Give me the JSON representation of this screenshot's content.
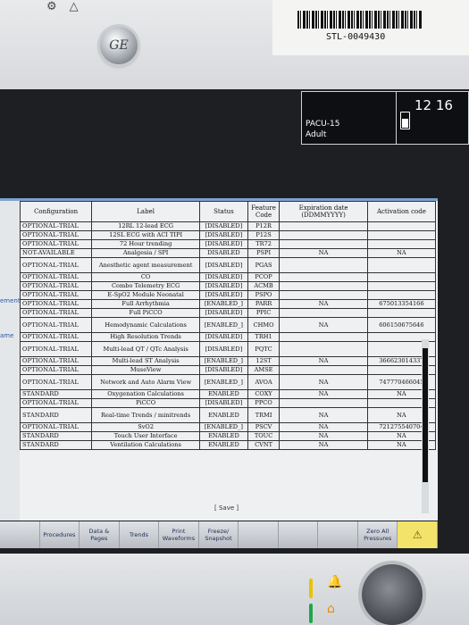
{
  "device": {
    "sticker_code": "STL-0049430",
    "logo": "GE"
  },
  "status": {
    "unit": "PACU-15",
    "patient_type": "Adult",
    "time": "12 16"
  },
  "side_labels": [
    "ement",
    "ame"
  ],
  "table": {
    "headers": [
      "Configuration",
      "Label",
      "Status",
      "Feature Code",
      "Expiration date (DDMMYYYY)",
      "Activation code"
    ],
    "rows": [
      {
        "conf": "OPTIONAL-TRIAL",
        "label": "12RL 12-lead ECG",
        "status": "[DISABLED]",
        "code": "P12R",
        "exp": "",
        "act": "",
        "tall": false
      },
      {
        "conf": "OPTIONAL-TRIAL",
        "label": "12SL ECG with ACI TIPI",
        "status": "[DISABLED]",
        "code": "P12S",
        "exp": "",
        "act": "",
        "tall": false
      },
      {
        "conf": "OPTIONAL-TRIAL",
        "label": "72 Hour trending",
        "status": "[DISABLED]",
        "code": "TR72",
        "exp": "",
        "act": "",
        "tall": false
      },
      {
        "conf": "NOT-AVAILABLE",
        "label": "Analgesia / SPI",
        "status": "DISABLED",
        "code": "PSPI",
        "exp": "NA",
        "act": "NA",
        "tall": false
      },
      {
        "conf": "OPTIONAL-TRIAL",
        "label": "Anesthetic agent measurement",
        "status": "[DISABLED]",
        "code": "PGAS",
        "exp": "",
        "act": "",
        "tall": true
      },
      {
        "conf": "OPTIONAL-TRIAL",
        "label": "CO",
        "status": "[DISABLED]",
        "code": "PCOP",
        "exp": "",
        "act": "",
        "tall": false
      },
      {
        "conf": "OPTIONAL-TRIAL",
        "label": "Combo Telemetry ECG",
        "status": "[DISABLED]",
        "code": "ACMB",
        "exp": "",
        "act": "",
        "tall": false
      },
      {
        "conf": "OPTIONAL-TRIAL",
        "label": "E-SpO2 Module Neonatal",
        "status": "[DISABLED]",
        "code": "PSPO",
        "exp": "",
        "act": "",
        "tall": false
      },
      {
        "conf": "OPTIONAL-TRIAL",
        "label": "Full Arrhythmia",
        "status": "[ENABLED_]",
        "code": "PARR",
        "exp": "NA",
        "act": "675013354166",
        "tall": false
      },
      {
        "conf": "OPTIONAL-TRIAL",
        "label": "Full PiCCO",
        "status": "[DISABLED]",
        "code": "PPIC",
        "exp": "",
        "act": "",
        "tall": false
      },
      {
        "conf": "OPTIONAL-TRIAL",
        "label": "Hemodynamic Calculations",
        "status": "[ENABLED_]",
        "code": "CHMO",
        "exp": "NA",
        "act": "606150675646",
        "tall": true
      },
      {
        "conf": "OPTIONAL-TRIAL",
        "label": "High Resolution Trends",
        "status": "[DISABLED]",
        "code": "TRH1",
        "exp": "",
        "act": "",
        "tall": false
      },
      {
        "conf": "OPTIONAL-TRIAL",
        "label": "Multi-lead QT / QTc Analysis",
        "status": "[DISABLED]",
        "code": "PQTC",
        "exp": "",
        "act": "",
        "tall": true
      },
      {
        "conf": "OPTIONAL-TRIAL",
        "label": "Multi-lead ST Analysis",
        "status": "[ENABLED_]",
        "code": "12ST",
        "exp": "NA",
        "act": "366623014337",
        "tall": false
      },
      {
        "conf": "OPTIONAL-TRIAL",
        "label": "MuseView",
        "status": "[DISABLED]",
        "code": "AMSE",
        "exp": "",
        "act": "",
        "tall": false
      },
      {
        "conf": "OPTIONAL-TRIAL",
        "label": "Network and Auto Alarm View",
        "status": "[ENABLED_]",
        "code": "AVOA",
        "exp": "NA",
        "act": "747770466045",
        "tall": true
      },
      {
        "conf": "STANDARD",
        "label": "Oxygenation Calculations",
        "status": "ENABLED",
        "code": "COXY",
        "exp": "NA",
        "act": "NA",
        "tall": false
      },
      {
        "conf": "OPTIONAL-TRIAL",
        "label": "PiCCO",
        "status": "[DISABLED]",
        "code": "PPCO",
        "exp": "",
        "act": "",
        "tall": false
      },
      {
        "conf": "STANDARD",
        "label": "Real-time Trends / minitrends",
        "status": "ENABLED",
        "code": "TRMI",
        "exp": "NA",
        "act": "NA",
        "tall": true
      },
      {
        "conf": "OPTIONAL-TRIAL",
        "label": "SvO2",
        "status": "[ENABLED_]",
        "code": "PSCV",
        "exp": "NA",
        "act": "721275540704",
        "tall": false
      },
      {
        "conf": "STANDARD",
        "label": "Touch User Interface",
        "status": "ENABLED",
        "code": "TOUC",
        "exp": "NA",
        "act": "NA",
        "tall": false
      },
      {
        "conf": "STANDARD",
        "label": "Ventilation Calculations",
        "status": "ENABLED",
        "code": "CVNT",
        "exp": "NA",
        "act": "NA",
        "tall": false
      }
    ]
  },
  "save_label": "[ Save ]",
  "softkeys": [
    "",
    "Procedures",
    "Data & Pages",
    "Trends",
    "Print Waveforms",
    "Freeze/ Snapshot",
    "",
    "",
    "",
    "Zero All Pressures",
    "⚠"
  ]
}
